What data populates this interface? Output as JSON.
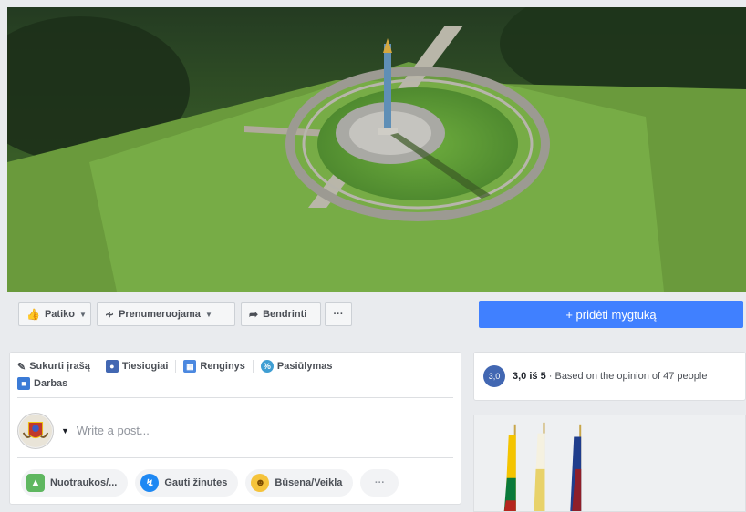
{
  "actions": {
    "like_label": "Patiko",
    "subscribe_label": "Prenumeruojama",
    "share_label": "Bendrinti",
    "more_label": "···",
    "add_button_label": "+ pridėti mygtuką"
  },
  "composer": {
    "tabs": [
      {
        "label": "Sukurti įrašą",
        "icon": "pencil-icon"
      },
      {
        "label": "Tiesiogiai",
        "icon": "live-video-icon"
      },
      {
        "label": "Renginys",
        "icon": "calendar-icon"
      },
      {
        "label": "Pasiūlymas",
        "icon": "offer-icon"
      },
      {
        "label": "Darbas",
        "icon": "briefcase-icon"
      }
    ],
    "placeholder": "Write a post...",
    "pills": [
      {
        "label": "Nuotraukos/...",
        "icon": "photo-icon"
      },
      {
        "label": "Gauti žinutes",
        "icon": "messenger-icon"
      },
      {
        "label": "Būsena/Veikla",
        "icon": "emoji-icon"
      }
    ],
    "more_label": "···"
  },
  "rating": {
    "badge": "3,0",
    "score_text": "3,0 iš 5",
    "detail_text": " · Based on the opinion of 47 people"
  },
  "colors": {
    "accent": "#4080ff",
    "brand": "#4267b2"
  }
}
